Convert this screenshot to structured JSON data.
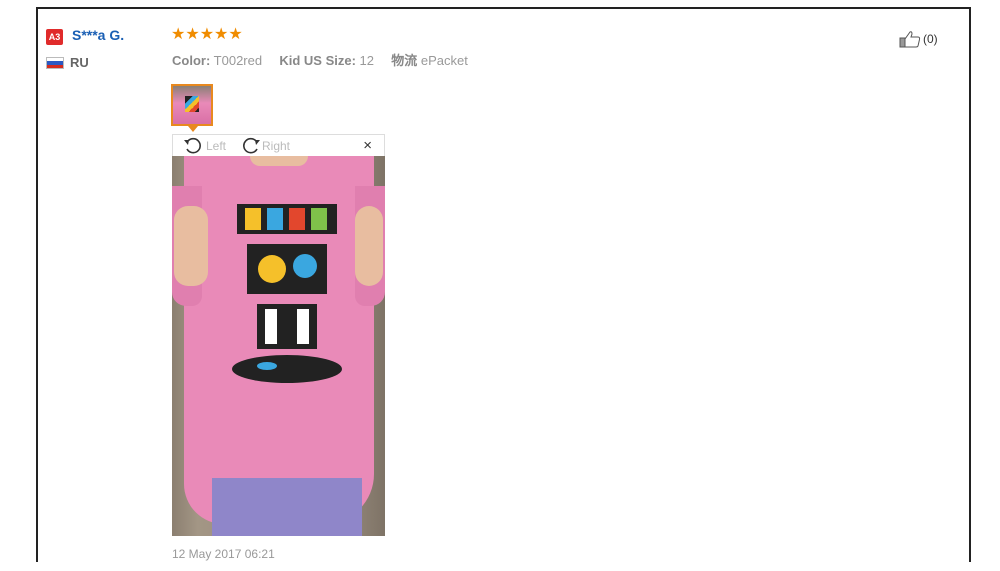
{
  "review": {
    "badge": "A3",
    "username": "S***a G.",
    "country": "RU",
    "stars": "★★★★★",
    "rating": 5,
    "attributes": {
      "color_label": "Color:",
      "color_value": "T002red",
      "size_label": "Kid US Size:",
      "size_value": "12",
      "shipping_label": "物流",
      "shipping_value": "ePacket"
    },
    "helpful_count": "(0)",
    "viewer": {
      "rotate_left": "Left",
      "rotate_right": "Right",
      "close": "×"
    },
    "date": "12 May 2017 06:21"
  },
  "colors": {
    "username": "#1a5fb4",
    "stars": "#f08c00",
    "badge": "#e02b2b",
    "thumb_border": "#e8891f"
  },
  "icons": {
    "like": "thumbs-up-icon",
    "rotate_left": "rotate-left-icon",
    "rotate_right": "rotate-right-icon",
    "close": "close-icon",
    "flag": "russia-flag-icon"
  }
}
